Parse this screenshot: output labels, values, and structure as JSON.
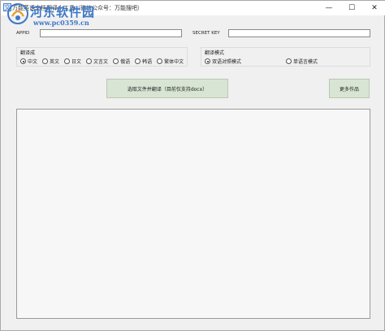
{
  "window": {
    "title": "万能英语文档翻译小工具（微信公众号：万能搜吧）",
    "controls": {
      "minimize": "—",
      "maximize": "☐",
      "close": "✕"
    }
  },
  "watermark": {
    "title": "河东软件园",
    "url": "www.pc0359.cn"
  },
  "credentials": {
    "appid_label": "APPID",
    "appid_value": "",
    "secret_label": "SECRET KEY",
    "secret_value": ""
  },
  "translate_to": {
    "title": "翻译成",
    "options": [
      {
        "label": "中文",
        "checked": true
      },
      {
        "label": "英文",
        "checked": false
      },
      {
        "label": "日文",
        "checked": false
      },
      {
        "label": "文言文",
        "checked": false
      },
      {
        "label": "俄语",
        "checked": false
      },
      {
        "label": "韩语",
        "checked": false
      },
      {
        "label": "繁体中文",
        "checked": false
      }
    ]
  },
  "translate_mode": {
    "title": "翻译模式",
    "options": [
      {
        "label": "双语对照模式",
        "checked": true
      },
      {
        "label": "单语言模式",
        "checked": false
      }
    ]
  },
  "buttons": {
    "select_translate": "选取文件并翻译（目前仅支持docx）",
    "more_works": "更多作品"
  },
  "output": {
    "text": ""
  },
  "colors": {
    "button_bg": "#d8e5d4",
    "watermark": "#3d77c6",
    "window_bg": "#f0f0f0"
  }
}
